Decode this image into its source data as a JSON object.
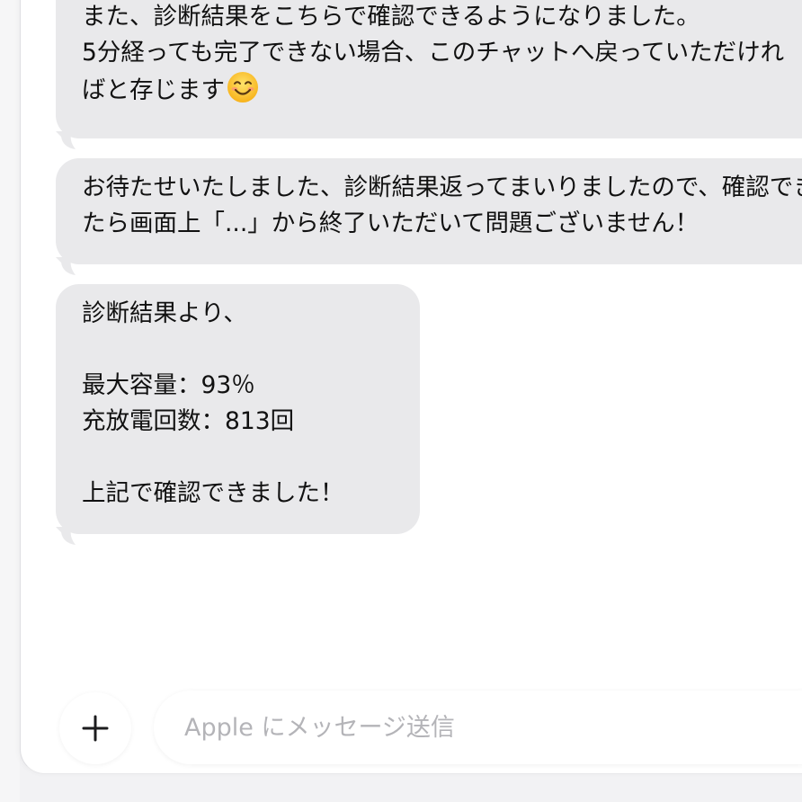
{
  "messages": [
    {
      "lines": [
        "また、診断結果をこちらで確認できるようになりました。",
        "5分経っても完了できない場合、このチャットへ戻っていただけれ",
        "ばと存じます"
      ],
      "emoji": "smiling-face-emoji"
    },
    {
      "lines": [
        "お待たせいたしました、診断結果返ってまいりましたので、確認でき",
        "たら画面上「...」から終了いただいて問題ございません！"
      ]
    },
    {
      "lines": [
        "診断結果より、",
        "",
        "最大容量：93％",
        "充放電回数：813回",
        "",
        "上記で確認できました！"
      ]
    }
  ],
  "composer": {
    "add_icon": "plus-icon",
    "placeholder": "Apple にメッセージ送信"
  },
  "colors": {
    "bubble_bg": "#e9e9eb",
    "placeholder": "#b4b4b8",
    "background": "#ffffff"
  }
}
